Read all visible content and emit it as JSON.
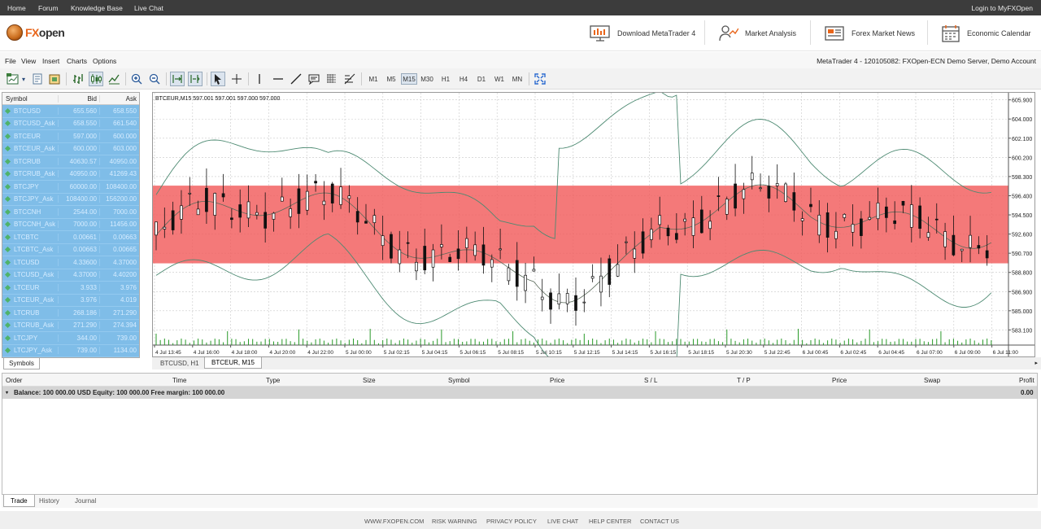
{
  "topbar": {
    "links": [
      "Home",
      "Forum",
      "Knowledge Base",
      "Live Chat"
    ],
    "login": "Login to MyFXOpen"
  },
  "header": {
    "logo_text": "FXopen",
    "buttons": [
      {
        "label": "Download MetaTrader 4",
        "icon": "monitor-chart-icon"
      },
      {
        "label": "Market Analysis",
        "icon": "analyst-icon"
      },
      {
        "label": "Forex Market News",
        "icon": "newspaper-icon"
      },
      {
        "label": "Economic Calendar",
        "icon": "calendar-icon"
      }
    ]
  },
  "menu": {
    "items": [
      "File",
      "View",
      "Insert",
      "Charts",
      "Options"
    ],
    "account": "MetaTrader 4 - 120105082: FXOpen-ECN Demo Server, Demo Account"
  },
  "toolbar": {
    "timeframes": [
      "M1",
      "M5",
      "M15",
      "M30",
      "H1",
      "H4",
      "D1",
      "W1",
      "MN"
    ],
    "selected_timeframe": "M15"
  },
  "market_watch": {
    "headers": {
      "symbol": "Symbol",
      "bid": "Bid",
      "ask": "Ask"
    },
    "rows": [
      {
        "symbol": "BTCUSD",
        "bid": "655.560",
        "ask": "658.550"
      },
      {
        "symbol": "BTCUSD_Ask",
        "bid": "658.550",
        "ask": "661.540"
      },
      {
        "symbol": "BTCEUR",
        "bid": "597.000",
        "ask": "600.000"
      },
      {
        "symbol": "BTCEUR_Ask",
        "bid": "600.000",
        "ask": "603.000"
      },
      {
        "symbol": "BTCRUB",
        "bid": "40630.57",
        "ask": "40950.00"
      },
      {
        "symbol": "BTCRUB_Ask",
        "bid": "40950.00",
        "ask": "41269.43"
      },
      {
        "symbol": "BTCJPY",
        "bid": "60000.00",
        "ask": "108400.00"
      },
      {
        "symbol": "BTCJPY_Ask",
        "bid": "108400.00",
        "ask": "156200.00"
      },
      {
        "symbol": "BTCCNH",
        "bid": "2544.00",
        "ask": "7000.00"
      },
      {
        "symbol": "BTCCNH_Ask",
        "bid": "7000.00",
        "ask": "11456.00"
      },
      {
        "symbol": "LTCBTC",
        "bid": "0.00661",
        "ask": "0.00663"
      },
      {
        "symbol": "LTCBTC_Ask",
        "bid": "0.00663",
        "ask": "0.00665"
      },
      {
        "symbol": "LTCUSD",
        "bid": "4.33600",
        "ask": "4.37000"
      },
      {
        "symbol": "LTCUSD_Ask",
        "bid": "4.37000",
        "ask": "4.40200"
      },
      {
        "symbol": "LTCEUR",
        "bid": "3.933",
        "ask": "3.976"
      },
      {
        "symbol": "LTCEUR_Ask",
        "bid": "3.976",
        "ask": "4.019"
      },
      {
        "symbol": "LTCRUB",
        "bid": "268.186",
        "ask": "271.290"
      },
      {
        "symbol": "LTCRUB_Ask",
        "bid": "271.290",
        "ask": "274.394"
      },
      {
        "symbol": "LTCJPY",
        "bid": "344.00",
        "ask": "739.00"
      },
      {
        "symbol": "LTCJPY_Ask",
        "bid": "739.00",
        "ask": "1134.00"
      }
    ],
    "tab": "Symbols"
  },
  "chart": {
    "legend": "BTCEUR,M15  597.001 597.001 597.000 597.000",
    "price_labels": [
      "605.900",
      "604.000",
      "602.100",
      "600.200",
      "598.300",
      "596.400",
      "594.500",
      "592.600",
      "590.700",
      "588.800",
      "586.900",
      "585.000",
      "583.100"
    ],
    "price_min": 581.6,
    "price_max": 606.6,
    "band_low": 589.7,
    "band_high": 597.4,
    "band_color": "#f25c5c",
    "time_labels": [
      "4 Jul 13:45",
      "4 Jul 16:00",
      "4 Jul 18:00",
      "4 Jul 20:00",
      "4 Jul 22:00",
      "5 Jul 00:00",
      "5 Jul 02:15",
      "5 Jul 04:15",
      "5 Jul 06:15",
      "5 Jul 08:15",
      "5 Jul 10:15",
      "5 Jul 12:15",
      "5 Jul 14:15",
      "5 Jul 16:15",
      "5 Jul 18:15",
      "5 Jul 20:30",
      "5 Jul 22:45",
      "6 Jul 00:45",
      "6 Jul 02:45",
      "6 Jul 04:45",
      "6 Jul 07:00",
      "6 Jul 09:00",
      "6 Jul 11:00"
    ],
    "tabs": [
      "BTCUSD, H1",
      "BTCEUR, M15"
    ]
  },
  "terminal": {
    "headers": [
      "Order",
      "Time",
      "Type",
      "Size",
      "Symbol",
      "Price",
      "S / L",
      "T / P",
      "Price",
      "Swap",
      "Profit"
    ],
    "balance": "Balance: 100 000.00 USD  Equity: 100 000.00  Free margin: 100 000.00",
    "profit": "0.00",
    "tabs": [
      "Trade",
      "History",
      "Journal"
    ]
  },
  "footer": {
    "links": [
      "WWW.FXOPEN.COM",
      "RISK WARNING",
      "PRIVACY POLICY",
      "LIVE CHAT",
      "HELP CENTER",
      "CONTACT US"
    ]
  }
}
